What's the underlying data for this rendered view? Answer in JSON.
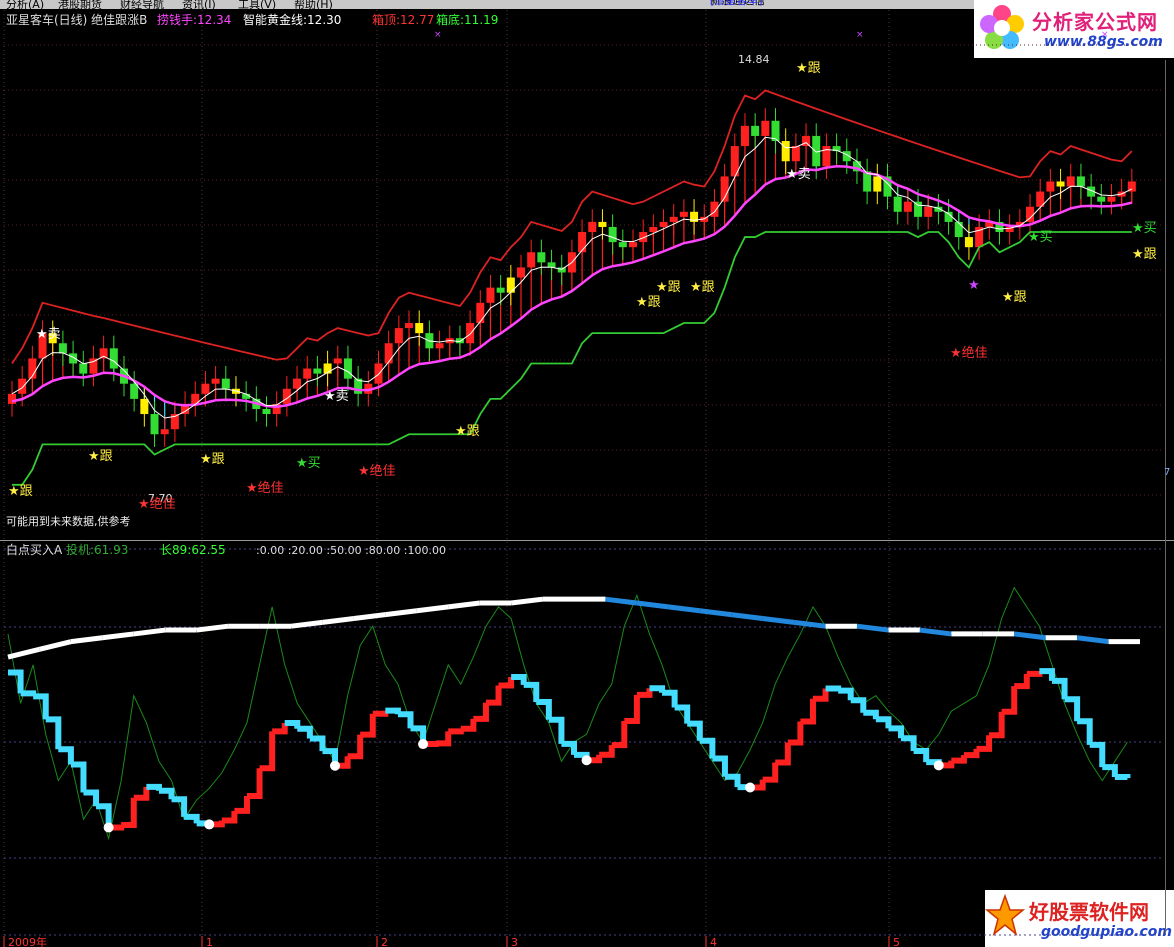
{
  "menu": [
    "分析(A)",
    "港股期货",
    "财经导航",
    "资讯(I)",
    "工具(V)",
    "帮助(H)"
  ],
  "news": {
    "text": "新浪通达信",
    "stock": "[亚星客车]"
  },
  "logo_top": {
    "name": "分析家公式网",
    "url": "www.88gs.com"
  },
  "logo_bottom": {
    "name": "好股票软件网",
    "url": "goodgupiao.com"
  },
  "top_header": {
    "title": "亚星客车(日线) 绝佳跟涨B",
    "items": [
      {
        "label": "捞钱手:",
        "value": "12.34",
        "color": "#ff44ff"
      },
      {
        "label": "智能黄金线:",
        "value": "12.30",
        "color": "#ffffff"
      },
      {
        "label": "箱顶:",
        "value": "12.77",
        "color": "#ff3333"
      },
      {
        "label": "箱底:",
        "value": "11.19",
        "color": "#33ff33"
      }
    ]
  },
  "top_note": "可能用到未来数据,供参考",
  "bottom_header": {
    "title": "白点买入A",
    "items": [
      {
        "label": "投机:",
        "value": "61.93",
        "color": "#33aa33"
      },
      {
        "label": "长89:",
        "value": "62.55",
        "color": "#33ff33"
      }
    ],
    "levels": ":0.00  :20.00  :50.00  :80.00  :100.00"
  },
  "x_axis": {
    "labels": [
      "2009年",
      "1",
      "2",
      "3",
      "4",
      "5"
    ]
  },
  "right_edge_label": "7",
  "colors": {
    "up": "#ff2020",
    "down": "#33dd33",
    "hi": "#ffee00",
    "mag": "#ff44ff",
    "cyan": "#44ddff",
    "white": "#ffffff",
    "blue": "#2288dd",
    "boxTop": "#dd2222",
    "boxBot": "#33cc33"
  },
  "chart_data": [
    {
      "type": "candlestick",
      "title": "亚星客车(日线) 绝佳跟涨B",
      "price_range": [
        6.5,
        15.4
      ],
      "annotations": {
        "high": "14.84",
        "low": "7.70"
      },
      "closes": [
        8.6,
        8.9,
        9.3,
        9.8,
        9.6,
        9.4,
        9.2,
        9.0,
        9.3,
        9.5,
        9.1,
        8.8,
        8.5,
        8.2,
        7.8,
        7.9,
        8.2,
        8.4,
        8.6,
        8.8,
        8.9,
        8.7,
        8.6,
        8.5,
        8.3,
        8.2,
        8.4,
        8.7,
        8.9,
        9.1,
        9.0,
        9.2,
        9.3,
        8.9,
        8.6,
        8.8,
        9.2,
        9.6,
        9.9,
        10.0,
        9.8,
        9.5,
        9.6,
        9.7,
        9.6,
        10.0,
        10.4,
        10.7,
        10.6,
        10.9,
        11.1,
        11.4,
        11.2,
        11.1,
        11.0,
        11.4,
        11.8,
        12.0,
        11.9,
        11.6,
        11.5,
        11.6,
        11.8,
        11.9,
        12.0,
        12.1,
        12.2,
        12.0,
        12.1,
        12.4,
        12.9,
        13.5,
        13.9,
        13.7,
        14.0,
        13.6,
        13.2,
        13.5,
        13.7,
        13.1,
        13.5,
        13.4,
        13.2,
        13.0,
        12.6,
        12.9,
        12.5,
        12.2,
        12.4,
        12.1,
        12.3,
        12.2,
        12.0,
        11.7,
        11.5,
        11.9,
        12.0,
        11.8,
        11.9,
        12.0,
        12.3,
        12.6,
        12.8,
        12.7,
        12.9,
        12.7,
        12.5,
        12.4,
        12.5,
        12.6,
        12.8
      ],
      "zigzag_labels": [
        {
          "text": "★卖",
          "color": "#ffffff"
        },
        {
          "text": "★跟",
          "color": "#ffee44"
        },
        {
          "text": "★跟",
          "color": "#ffee44"
        },
        {
          "text": "★绝佳",
          "color": "#ff3333"
        },
        {
          "text": "★跟",
          "color": "#ffee44"
        },
        {
          "text": "★绝佳",
          "color": "#ff3333"
        },
        {
          "text": "★买",
          "color": "#33dd33"
        },
        {
          "text": "★卖",
          "color": "#ffffff"
        },
        {
          "text": "★绝佳",
          "color": "#ff3333"
        },
        {
          "text": "★跟",
          "color": "#ffee44"
        },
        {
          "text": "★跟",
          "color": "#ffee44"
        },
        {
          "text": "★跟",
          "color": "#ffee44"
        },
        {
          "text": "★跟",
          "color": "#ffee44"
        },
        {
          "text": "★卖",
          "color": "#ffffff"
        },
        {
          "text": "★跟",
          "color": "#ffee44"
        },
        {
          "text": "★",
          "color": "#cc44ff"
        },
        {
          "text": "★绝佳",
          "color": "#ff3333"
        },
        {
          "text": "★跟",
          "color": "#ffee44"
        },
        {
          "text": "★买",
          "color": "#33dd33"
        },
        {
          "text": "★买",
          "color": "#33dd33"
        },
        {
          "text": "★跟",
          "color": "#ffee44"
        }
      ]
    },
    {
      "type": "line",
      "title": "白点买入A",
      "ylim": [
        0,
        100
      ],
      "series": [
        {
          "name": "投机",
          "values": [
            78,
            60,
            70,
            52,
            40,
            45,
            30,
            35,
            25,
            40,
            62,
            55,
            45,
            40,
            30,
            35,
            38,
            42,
            48,
            55,
            70,
            85,
            70,
            60,
            55,
            50,
            45,
            62,
            75,
            80,
            70,
            65,
            55,
            50,
            60,
            70,
            65,
            72,
            80,
            85,
            82,
            70,
            60,
            55,
            45,
            50,
            52,
            60,
            65,
            80,
            88,
            78,
            70,
            60,
            55,
            50,
            45,
            40,
            42,
            48,
            55,
            65,
            72,
            78,
            85,
            80,
            72,
            65,
            60,
            62,
            58,
            55,
            50,
            48,
            52,
            58,
            60,
            62,
            70,
            82,
            90,
            85,
            80,
            70,
            60,
            52,
            45,
            40,
            45,
            50
          ]
        },
        {
          "name": "长89",
          "values": [
            72,
            74,
            76,
            77,
            78,
            79,
            79,
            80,
            80,
            80,
            81,
            82,
            83,
            84,
            85,
            86,
            86,
            87,
            87,
            87,
            86,
            85,
            84,
            83,
            82,
            81,
            80,
            80,
            79,
            79,
            78,
            78,
            78,
            77,
            77,
            76,
            76
          ]
        }
      ],
      "levels": [
        0,
        20,
        50,
        80,
        100
      ]
    }
  ]
}
